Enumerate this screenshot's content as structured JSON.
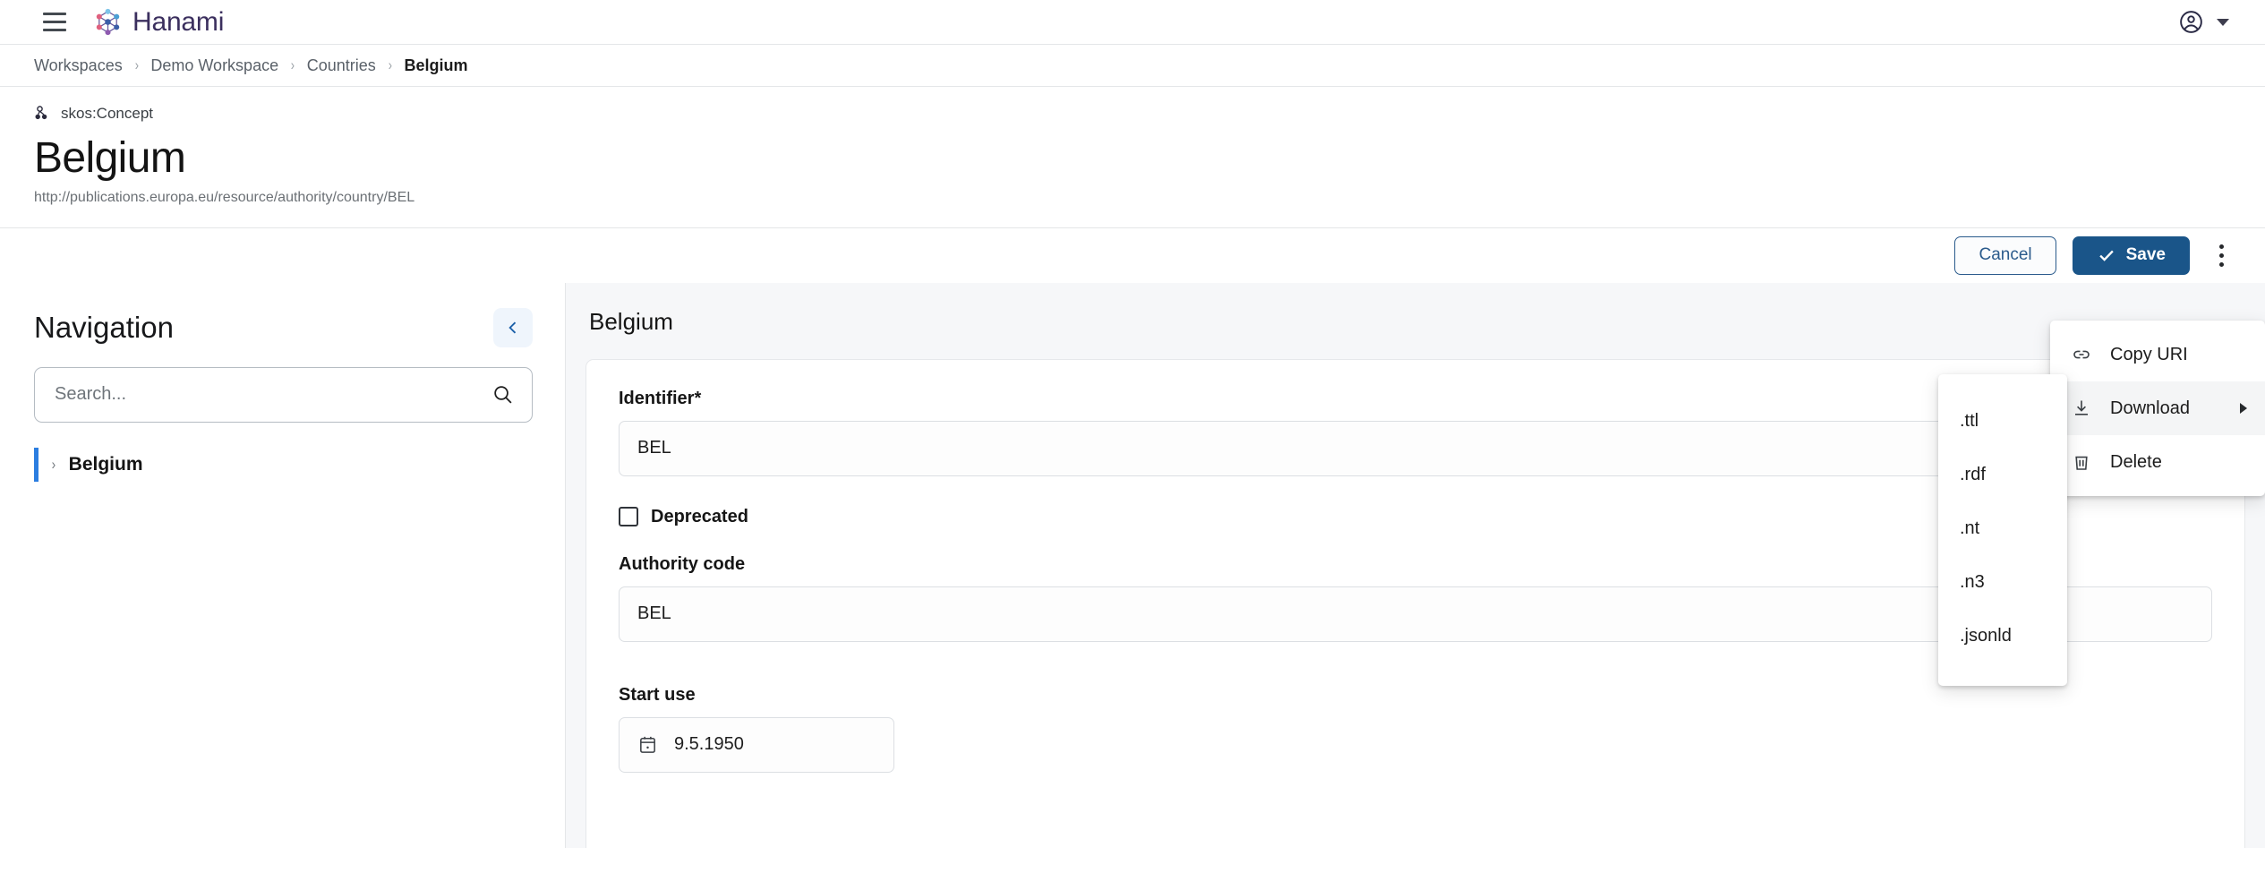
{
  "app": {
    "name": "Hanami",
    "menu_icon": "hamburger-menu-icon",
    "logo_icon": "hanami-graph-logo-icon",
    "account_icon": "account-circle-icon",
    "account_caret_icon": "chevron-down-icon"
  },
  "breadcrumb": {
    "separator": "›",
    "items": [
      {
        "label": "Workspaces",
        "current": false
      },
      {
        "label": "Demo Workspace",
        "current": false
      },
      {
        "label": "Countries",
        "current": false
      },
      {
        "label": "Belgium",
        "current": true
      }
    ]
  },
  "header": {
    "type_icon": "concept-node-icon",
    "type_label": "skos:Concept",
    "title": "Belgium",
    "uri": "http://publications.europa.eu/resource/authority/country/BEL"
  },
  "toolbar": {
    "cancel_label": "Cancel",
    "save_label": "Save",
    "save_icon": "check-icon",
    "more_icon": "kebab-menu-icon"
  },
  "more_menu": {
    "items": [
      {
        "label": "Copy URI",
        "icon": "link-icon",
        "highlighted": false,
        "has_submenu": false
      },
      {
        "label": "Download",
        "icon": "download-icon",
        "highlighted": true,
        "has_submenu": true
      },
      {
        "label": "Delete",
        "icon": "trash-icon",
        "highlighted": false,
        "has_submenu": false
      }
    ]
  },
  "download_submenu": {
    "items": [
      {
        "label": ".ttl"
      },
      {
        "label": ".rdf"
      },
      {
        "label": ".nt"
      },
      {
        "label": ".n3"
      },
      {
        "label": ".jsonld"
      }
    ]
  },
  "sidebar": {
    "title": "Navigation",
    "collapse_icon": "chevron-left-icon",
    "search": {
      "placeholder": "Search...",
      "value": "",
      "icon": "search-icon"
    },
    "tree": [
      {
        "label": "Belgium",
        "expand_icon": "chevron-right-icon",
        "selected": true
      }
    ]
  },
  "main": {
    "title": "Belgium",
    "fields": [
      {
        "label": "Identifier*",
        "value": "BEL",
        "type": "text"
      },
      {
        "label": "Deprecated",
        "value": "",
        "type": "checkbox",
        "checked": false
      },
      {
        "label": "Authority code",
        "value": "BEL",
        "type": "text"
      },
      {
        "label": "Start use",
        "value": "9.5.1950",
        "type": "date",
        "icon": "calendar-icon"
      }
    ]
  },
  "colors": {
    "brand_text": "#3b2f5e",
    "primary_button": "#1a5589",
    "cancel_border": "#2b5b8c",
    "tree_selected_bar": "#2b7de0",
    "main_background": "#f6f7f9",
    "collapse_button_bg": "#eff5fc"
  }
}
